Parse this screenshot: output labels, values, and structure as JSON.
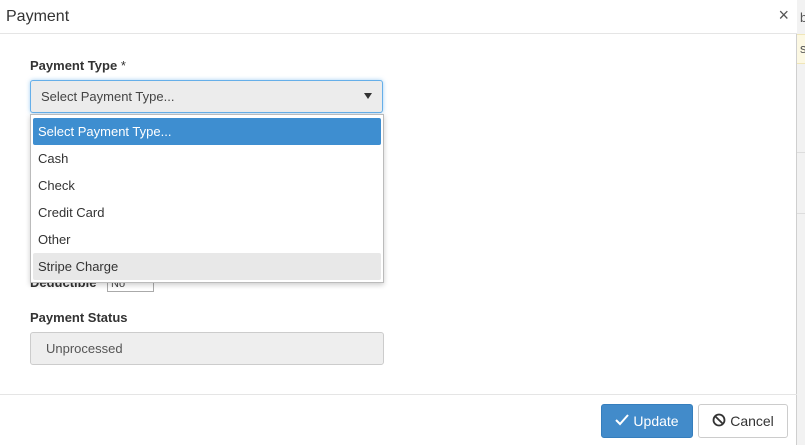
{
  "modal": {
    "title": "Payment",
    "close_glyph": "×"
  },
  "form": {
    "payment_type": {
      "label": "Payment Type",
      "required_mark": "*",
      "selected_value": "Select Payment Type...",
      "options": [
        "Select Payment Type...",
        "Cash",
        "Check",
        "Credit Card",
        "Other",
        "Stripe Charge"
      ]
    },
    "deductible": {
      "label": "Deductible",
      "value": "No"
    },
    "payment_status": {
      "label": "Payment Status",
      "value": "Unprocessed"
    }
  },
  "footer": {
    "update_label": "Update",
    "cancel_label": "Cancel"
  },
  "background_peek": {
    "char1": "b",
    "char2": "s"
  },
  "colors": {
    "primary": "#428bca",
    "selected_option": "#3e8ed0",
    "field_bg": "#eeeeee"
  },
  "icons": {
    "close": "close-icon",
    "caret": "caret-down-icon",
    "update": "check-icon",
    "cancel": "ban-icon"
  }
}
